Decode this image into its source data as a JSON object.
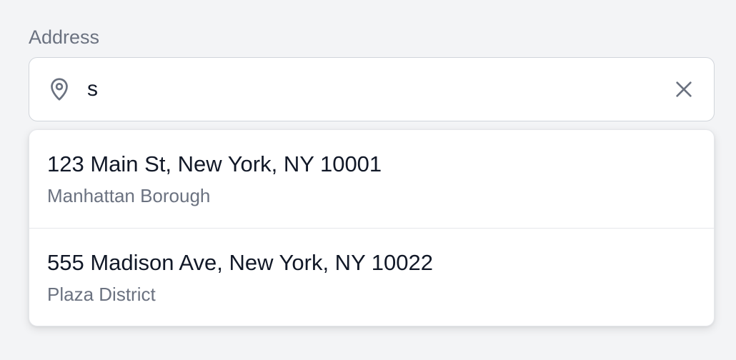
{
  "address_field": {
    "label": "Address",
    "value": "s",
    "icon": "map-pin-icon",
    "clear_icon": "close-icon"
  },
  "suggestions": [
    {
      "primary": "123 Main St, New York, NY 10001",
      "secondary": "Manhattan Borough"
    },
    {
      "primary": "555 Madison Ave, New York, NY 10022",
      "secondary": "Plaza District"
    }
  ],
  "colors": {
    "background": "#f3f4f6",
    "label_text": "#6b7280",
    "primary_text": "#111827",
    "secondary_text": "#6b7280",
    "border": "#d1d5db",
    "icon": "#6b7280"
  }
}
